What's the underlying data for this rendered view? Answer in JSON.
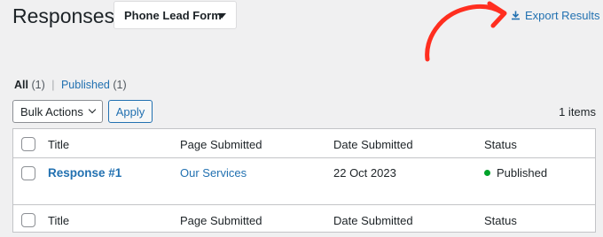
{
  "header": {
    "title": "Responses",
    "form_select": "Phone Lead Form",
    "export_label": "Export Results"
  },
  "filters": {
    "all_label": "All",
    "all_count": "(1)",
    "published_label": "Published",
    "published_count": "(1)"
  },
  "toolbar": {
    "bulk_actions": "Bulk Actions",
    "apply": "Apply",
    "items_count": "1 items"
  },
  "table": {
    "columns": [
      "Title",
      "Page Submitted",
      "Date Submitted",
      "Status"
    ],
    "rows": [
      {
        "title": "Response #1",
        "page": "Our Services",
        "date": "22 Oct 2023",
        "status": "Published"
      }
    ]
  },
  "colors": {
    "accent": "#2271b1",
    "status_published": "#00a32a",
    "annotation_arrow": "#ff2e1f"
  },
  "icons": {
    "export": "download-icon",
    "form_caret": "caret-down-icon",
    "bulk_chevron": "chevron-down-icon",
    "status": "status-dot-icon"
  }
}
